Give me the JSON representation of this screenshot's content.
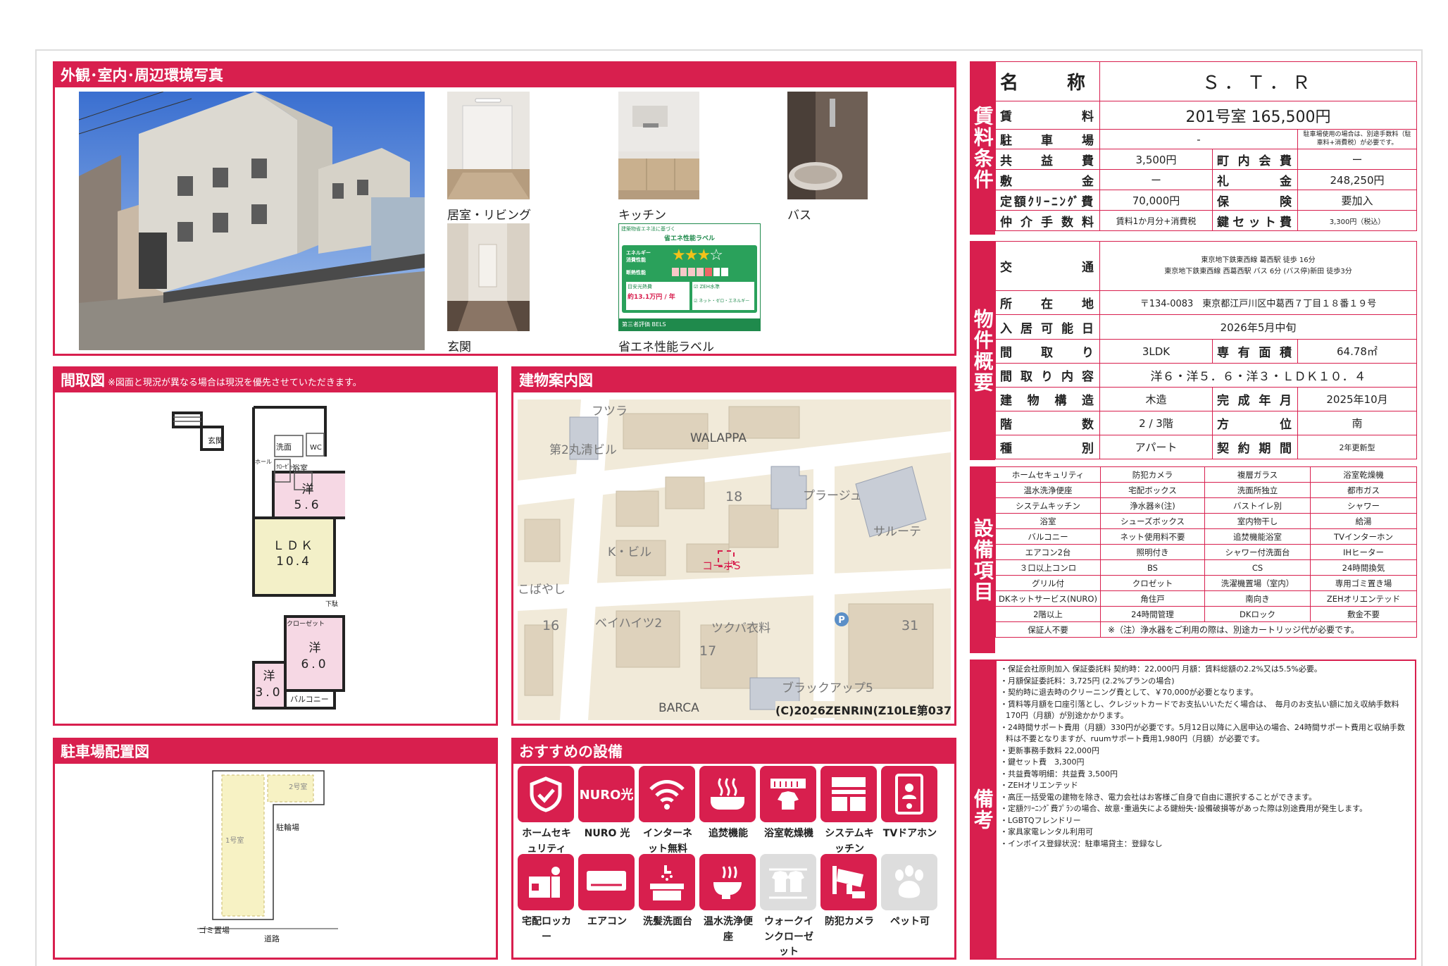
{
  "photos": {
    "title": "外観･室内･周辺環境写真",
    "captions": [
      "居室・リビング",
      "キッチン",
      "バス",
      "玄関",
      "省エネ性能ラベル"
    ],
    "label": {
      "top_left": "建築物省エネ法に基づく",
      "title": "省エネ性能ラベル",
      "row1": "エネルギー消費性能",
      "row2": "断熱性能",
      "cost_label": "目安光熱費",
      "cost_value": "約13.1万円 / 年",
      "zeh": "ZEH水準",
      "net_zero": "ネット・ゼロ・エネルギー",
      "footer": "第三者評価 BELS"
    }
  },
  "floorplan": {
    "title": "間取図",
    "note": "※図面と現況が異なる場合は現況を優先させていただきます。",
    "rooms": {
      "entrance": "玄関",
      "washroom": "洗面",
      "wc": "WC",
      "closet_v": "ｸﾛｰｾﾞｯﾄ",
      "bath": "浴室",
      "hall": "ホール",
      "r1": "洋",
      "r1_size": "5.6",
      "ldk": "ＬＤＫ",
      "ldk_size": "10.4",
      "shoebox": "下駄",
      "closet": "クローゼット",
      "r2": "洋",
      "r2_size": "6.0",
      "r3": "洋",
      "r3_size": "3.0",
      "balcony": "バルコニー"
    }
  },
  "guide_map": {
    "title": "建物案内図",
    "labels": [
      "フツラ",
      "第2丸清ビル",
      "WALAPPA",
      "18",
      "プラージュ",
      "サルーテ",
      "K・ビル",
      "コーポS",
      "こばやし",
      "16",
      "ベイハイツ2",
      "ツクバ衣料",
      "31",
      "17",
      "ブラックアップ5",
      "BARCA"
    ],
    "copyright": "(C)2026ZENRIN(Z10LE第037号)"
  },
  "parking": {
    "title": "駐車場配置図",
    "spot1": "1号室",
    "spot2": "2号室",
    "bike": "駐輪場",
    "garbage": "ゴミ置場",
    "road": "道路"
  },
  "recommend": {
    "title": "おすすめの設備",
    "items": [
      {
        "label": "ホームセキュリティ",
        "icon": "shield-icon",
        "active": true
      },
      {
        "label": "NURO 光",
        "icon": "nuro-icon",
        "active": true
      },
      {
        "label": "インターネット無料",
        "icon": "wifi-icon",
        "active": true
      },
      {
        "label": "追焚機能",
        "icon": "bathtub-icon",
        "active": true
      },
      {
        "label": "浴室乾燥機",
        "icon": "bath-dryer-icon",
        "active": true
      },
      {
        "label": "システムキッチン",
        "icon": "kitchen-icon",
        "active": true
      },
      {
        "label": "TVドアホン",
        "icon": "intercom-icon",
        "active": true
      },
      {
        "label": "宅配ロッカー",
        "icon": "locker-icon",
        "active": true
      },
      {
        "label": "エアコン",
        "icon": "aircon-icon",
        "active": true
      },
      {
        "label": "洗髪洗面台",
        "icon": "washbasin-icon",
        "active": true
      },
      {
        "label": "温水洗浄便座",
        "icon": "toilet-icon",
        "active": true
      },
      {
        "label": "ウォークインクローゼット",
        "icon": "closet-icon",
        "active": false
      },
      {
        "label": "防犯カメラ",
        "icon": "camera-icon",
        "active": true
      },
      {
        "label": "ペット可",
        "icon": "paw-icon",
        "active": false
      }
    ]
  },
  "rent": {
    "side": "賃料条件",
    "name_label": "名称",
    "name": "Ｓ．Ｔ．Ｒ",
    "rent_label": "賃料",
    "rent": "201号室 165,500円",
    "parking_label": "駐車場",
    "parking": "-",
    "parking_note": "駐車場使用の場合は、別途手数料（駐車料+消費税）が必要です。",
    "common_label": "共益費",
    "common": "3,500円",
    "town_label": "町内会費",
    "town": "ー",
    "deposit_label": "敷金",
    "deposit": "ー",
    "key_money_label": "礼金",
    "key_money": "248,250円",
    "cleaning_label": "定額ｸﾘｰﾆﾝｸﾞ費",
    "cleaning": "70,000円",
    "insurance_label": "保険",
    "insurance": "要加入",
    "brokerage_label": "仲介手数料",
    "brokerage": "賃料1か月分+消費税",
    "key_set_label": "鍵セット費",
    "key_set": "3,300円（税込）"
  },
  "property": {
    "side": "物件概要",
    "transport_label": "交通",
    "transport": [
      "東京地下鉄東西線 葛西駅 徒歩 16分",
      "東京地下鉄東西線 西葛西駅 バス 6分 (バス停)新田 徒歩3分"
    ],
    "address_label": "所在地",
    "address": "〒134-0083　東京都江戸川区中葛西７丁目１８番１９号",
    "move_in_label": "入居可能日",
    "move_in": "2026年5月中旬",
    "layout_label": "間取り",
    "layout": "3LDK",
    "area_label": "専有面積",
    "area": "64.78㎡",
    "layout_detail_label": "間取り内容",
    "layout_detail": "洋６・洋５．６・洋３・ＬＤＫ１０．４",
    "structure_label": "建物構造",
    "structure": "木造",
    "completed_label": "完成年月",
    "completed": "2025年10月",
    "floor_label": "階数",
    "floor": "2 / 3階",
    "direction_label": "方位",
    "direction": "南",
    "type_label": "種別",
    "type": "アパート",
    "contract_label": "契約期間",
    "contract": "2年更新型"
  },
  "equipment": {
    "side": "設備項目",
    "rows": [
      [
        "ホームセキュリティ",
        "防犯カメラ",
        "複層ガラス",
        "浴室乾燥機"
      ],
      [
        "温水洗浄便座",
        "宅配ボックス",
        "洗面所独立",
        "都市ガス"
      ],
      [
        "システムキッチン",
        "浄水器※(注)",
        "バストイレ別",
        "シャワー"
      ],
      [
        "浴室",
        "シューズボックス",
        "室内物干し",
        "給湯"
      ],
      [
        "バルコニー",
        "ネット使用料不要",
        "追焚機能浴室",
        "TVインターホン"
      ],
      [
        "エアコン2台",
        "照明付き",
        "シャワー付洗面台",
        "IHヒーター"
      ],
      [
        "３口以上コンロ",
        "BS",
        "CS",
        "24時間換気"
      ],
      [
        "グリル付",
        "クロゼット",
        "洗濯機置場（室内）",
        "専用ゴミ置き場"
      ],
      [
        "DKネットサービス(NURO)",
        "角住戸",
        "南向き",
        "ZEHオリエンテッド"
      ],
      [
        "2階以上",
        "24時間管理",
        "DKロック",
        "敷金不要"
      ]
    ],
    "last_left": "保証人不要",
    "last_note": "※（注）浄水器をご利用の際は、別途カートリッジ代が必要です。"
  },
  "remarks": {
    "side": "備考",
    "lines": [
      "・保証会社原則加入 保証委託料 契約時：22,000円 月額：賃料総額の2.2%又は5.5%必要。",
      "・月額保証委託料：3,725円 (2.2%プランの場合)",
      "・契約時に退去時のクリーニング費として、￥70,000が必要となります。",
      "・賃料等月額を口座引落とし、クレジットカードでお支払いいただく場合は、　毎月のお支払い額に加え収納手数料 170円（月額）が別途かかります。",
      "・24時間サポート費用（月額）330円が必要です。5月12日以降に入居申込の場合、24時間サポート費用と収納手数料は不要となりますが、ruumサポート費用1,980円（月額）が必要です。",
      "・更新事務手数料 22,000円",
      "・鍵セット費　3,300円",
      "・共益費等明細：共益費 3,500円",
      "・ZEHオリエンテッド",
      "・高圧一括受電の建物を除き、電力会社はお客様ご自身で自由に選択することができます。",
      "・定額ｸﾘｰﾆﾝｸﾞ費ﾌﾟﾗﾝの場合、故意･重過失による鍵紛失･設備破損等があった際は別途費用が発生します。",
      "・LGBTQフレンドリー",
      "・家具家電レンタル利用可",
      "・インボイス登録状況：駐車場貸主：登録なし"
    ]
  }
}
